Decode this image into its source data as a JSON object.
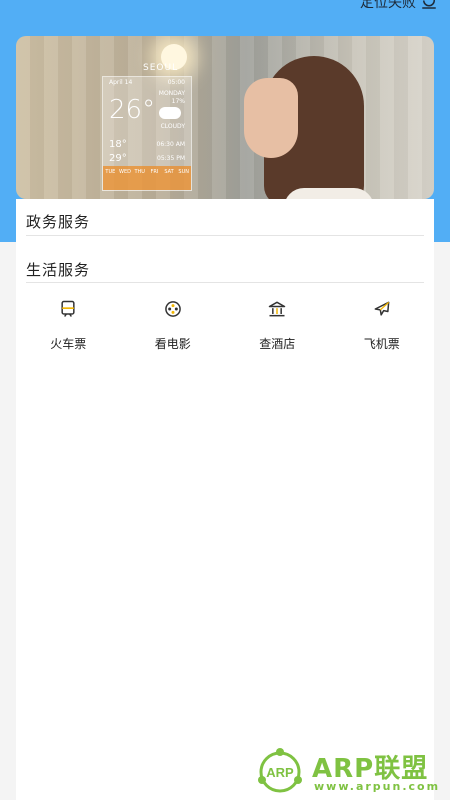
{
  "header": {
    "location_status": "定位失败",
    "location_icon": "location-refresh-icon",
    "accent": "#52aef5"
  },
  "banner": {
    "weather": {
      "city": "SEOUL",
      "date": "April 14",
      "time": "05:00",
      "temperature": "26°",
      "day": "MONDAY",
      "day_detail": "17%",
      "condition": "CLOUDY",
      "low": "18°",
      "high": "29°",
      "sunrise": "06:30 AM",
      "sunset": "05:35 PM",
      "forecast_days": [
        "TUE",
        "WED",
        "THU",
        "FRI",
        "SAT",
        "SUN"
      ]
    }
  },
  "sections": {
    "government": {
      "title": "政务服务"
    },
    "life": {
      "title": "生活服务",
      "items": [
        {
          "label": "火车票",
          "icon": "train-icon"
        },
        {
          "label": "看电影",
          "icon": "film-reel-icon"
        },
        {
          "label": "查酒店",
          "icon": "hotel-icon"
        },
        {
          "label": "飞机票",
          "icon": "airplane-icon"
        }
      ]
    }
  },
  "watermark": {
    "logo_text": "ARP",
    "name": "ARP联盟",
    "url": "www.arpun.com",
    "color": "#7fc242"
  }
}
